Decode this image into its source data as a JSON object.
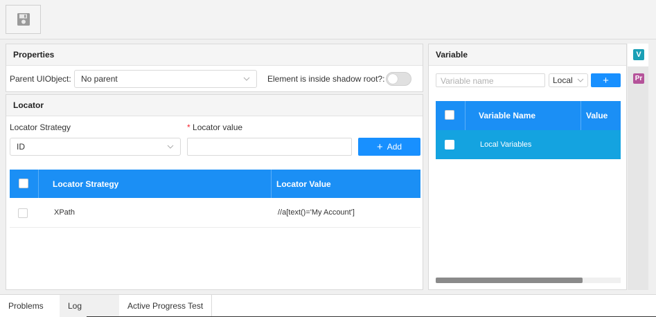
{
  "toolbar": {
    "save_icon": "floppy-disk-icon"
  },
  "properties": {
    "title": "Properties",
    "parent_label": "Parent UIObject:",
    "parent_value": "No parent",
    "shadow_label": "Element is inside shadow root?:",
    "shadow_enabled": false
  },
  "locator": {
    "title": "Locator",
    "strategy_label": "Locator Strategy",
    "strategy_value": "ID",
    "required_mark": "*",
    "value_label": "Locator value",
    "value_input": "",
    "add_label": "Add",
    "add_plus": "+",
    "table": {
      "headers": [
        "Locator Strategy",
        "Locator Value"
      ],
      "rows": [
        {
          "strategy": "XPath",
          "value": "//a[text()='My Account']"
        }
      ]
    }
  },
  "variable": {
    "title": "Variable",
    "name_placeholder": "Variable name",
    "scope_value": "Local",
    "add_plus": "+",
    "table": {
      "headers": [
        "Variable Name",
        "Value"
      ],
      "rows": [
        {
          "name": "Local Variables",
          "value": ""
        }
      ]
    }
  },
  "sidebar": {
    "tabs": [
      {
        "label": "V",
        "color": "#1a9fb5"
      },
      {
        "label": "Pr",
        "color": "#b5539a"
      }
    ]
  },
  "bottom_tabs": [
    "Problems",
    "Log",
    "Active Progress Test"
  ],
  "colors": {
    "primary": "#1890ff",
    "row_selected": "#14a3e0"
  }
}
